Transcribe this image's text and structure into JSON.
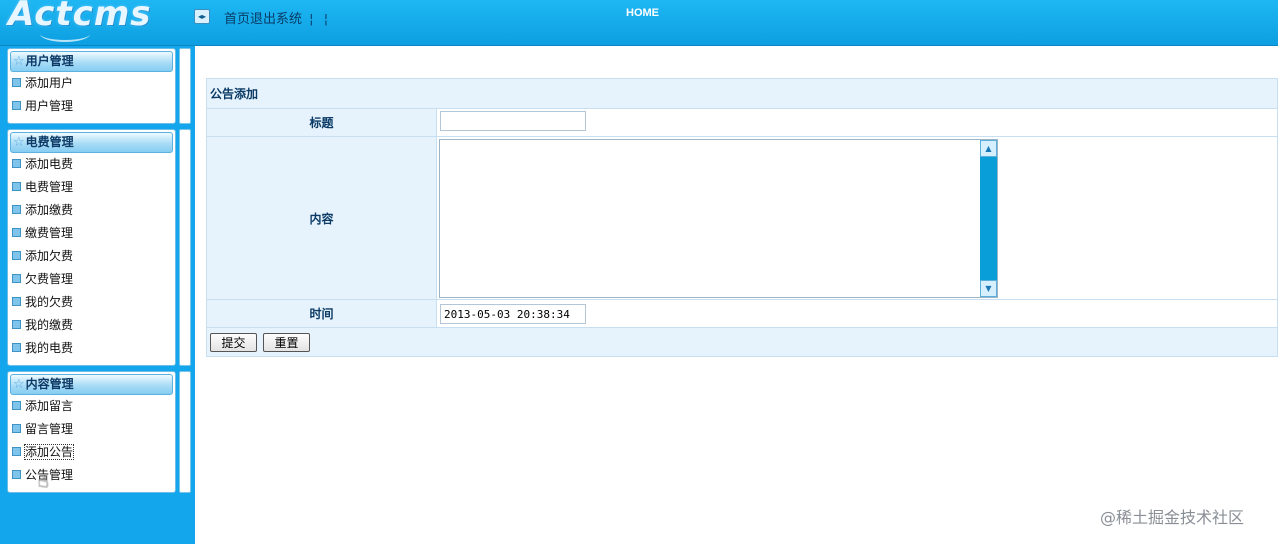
{
  "header": {
    "logo_text": "Actcms",
    "toggle_icon": "◂▸",
    "nav_text": "首页退出系统",
    "nav_sep1": "¦",
    "nav_sep2": "¦",
    "home_label": "HOME"
  },
  "sidebar": {
    "sections": [
      {
        "title": "用户管理",
        "items": [
          "添加用户",
          "用户管理"
        ]
      },
      {
        "title": "电费管理",
        "items": [
          "添加电费",
          "电费管理",
          "添加缴费",
          "缴费管理",
          "添加欠费",
          "欠费管理",
          "我的欠费",
          "我的缴费",
          "我的电费"
        ]
      },
      {
        "title": "内容管理",
        "items": [
          "添加留言",
          "留言管理",
          "添加公告",
          "公告管理"
        ]
      }
    ]
  },
  "form": {
    "caption": "公告添加",
    "title_label": "标题",
    "title_value": "",
    "content_label": "内容",
    "time_label": "时间",
    "time_value": "2013-05-03 20:38:34",
    "submit_label": "提交",
    "reset_label": "重置"
  },
  "watermark": "@稀土掘金技术社区",
  "colors": {
    "topbar": "#1eb7f3",
    "sidebar": "#14a6ec",
    "label_bg": "#e6f3fd",
    "label_text": "#0b3b66"
  }
}
